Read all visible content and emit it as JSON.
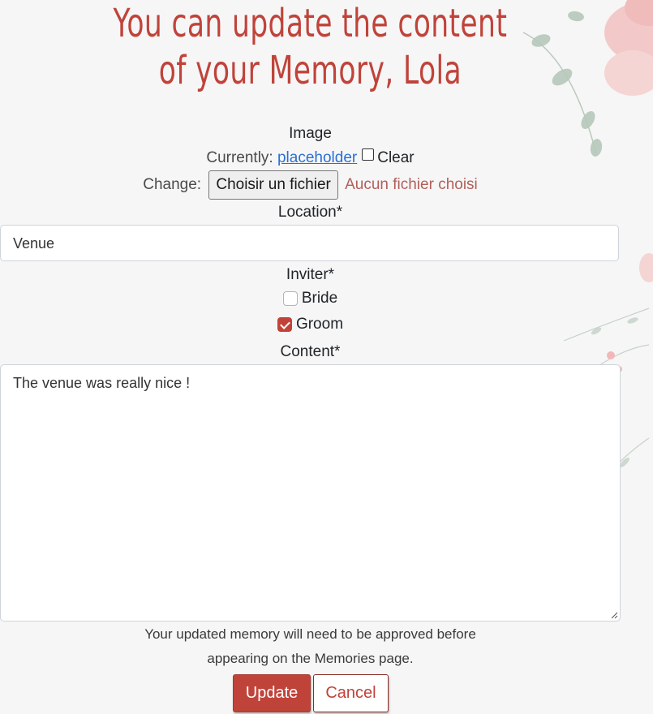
{
  "heading": {
    "line1": "You can update the content",
    "line2": "of your Memory, Lola"
  },
  "image_field": {
    "label": "Image",
    "currently_label": "Currently:",
    "current_link": "placeholder",
    "clear_label": "Clear",
    "change_label": "Change:",
    "file_button": "Choisir un fichier",
    "no_file_text": "Aucun fichier choisi"
  },
  "location_field": {
    "label": "Location*",
    "value": "Venue"
  },
  "inviter_field": {
    "label": "Inviter*",
    "options": [
      {
        "label": "Bride",
        "checked": false
      },
      {
        "label": "Groom",
        "checked": true
      }
    ]
  },
  "content_field": {
    "label": "Content*",
    "value": "The venue was really nice !"
  },
  "note": {
    "line1": "Your updated memory will need to be approved before",
    "line2": "appearing on the Memories page."
  },
  "buttons": {
    "update": "Update",
    "cancel": "Cancel"
  },
  "colors": {
    "accent": "#c0433a",
    "background": "#f6f6f6"
  }
}
